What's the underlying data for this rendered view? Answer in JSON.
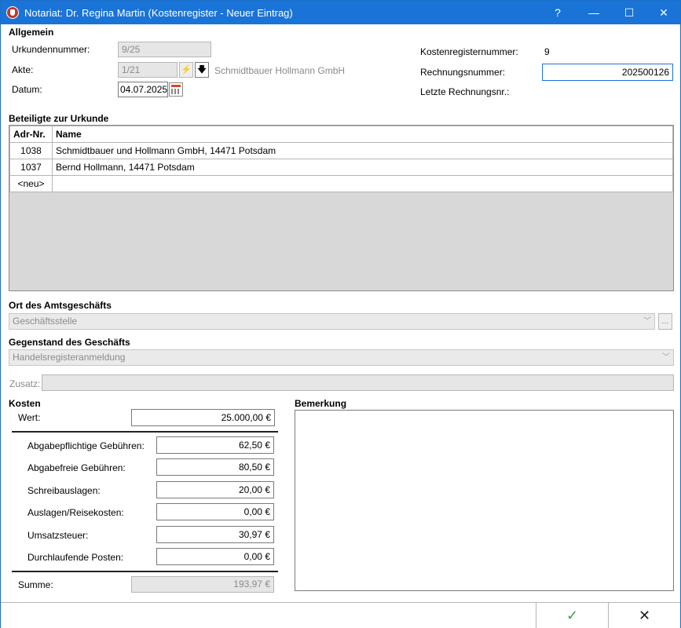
{
  "window": {
    "title": "Notariat: Dr. Regina Martin (Kostenregister - Neuer Eintrag)",
    "help": "?",
    "minimize": "—",
    "maximize": "☐",
    "close": "✕"
  },
  "allgemein": {
    "section": "Allgemein",
    "urkundennummer_label": "Urkundennummer:",
    "urkundennummer": "9/25",
    "akte_label": "Akte:",
    "akte": "1/21",
    "akte_btn1": "⚡",
    "akte_btn2": "🡇",
    "akte_name": "Schmidtbauer  Hollmann GmbH",
    "datum_label": "Datum:",
    "datum": "04.07.2025",
    "kostenregisternummer_label": "Kostenregisternummer:",
    "kostenregisternummer": "9",
    "rechnungsnummer_label": "Rechnungsnummer:",
    "rechnungsnummer": "202500126",
    "letzte_label": "Letzte Rechnungsnr.:"
  },
  "beteiligte": {
    "section": "Beteiligte zur Urkunde",
    "col_adr": "Adr-Nr.",
    "col_name": "Name",
    "rows": [
      {
        "adr": "1038",
        "name": "Schmidtbauer und Hollmann GmbH, 14471 Potsdam"
      },
      {
        "adr": "1037",
        "name": "Bernd Hollmann, 14471 Potsdam"
      },
      {
        "adr": "<neu>",
        "name": ""
      }
    ]
  },
  "ort": {
    "section": "Ort des Amtsgeschäfts",
    "value": "Geschäftsstelle",
    "btn": "..."
  },
  "gegenstand": {
    "section": "Gegenstand des Geschäfts",
    "value": "Handelsregisteranmeldung",
    "zusatz_label": "Zusatz:",
    "zusatz": ""
  },
  "kosten": {
    "section": "Kosten",
    "wert_label": "Wert:",
    "wert": "25.000,00 €",
    "items": [
      {
        "label": "Abgabepflichtige Gebühren:",
        "value": "62,50 €"
      },
      {
        "label": "Abgabefreie Gebühren:",
        "value": "80,50 €"
      },
      {
        "label": "Schreibauslagen:",
        "value": "20,00 €"
      },
      {
        "label": "Auslagen/Reisekosten:",
        "value": "0,00 €"
      },
      {
        "label": "Umsatzsteuer:",
        "value": "30,97 €"
      },
      {
        "label": "Durchlaufende Posten:",
        "value": "0,00 €"
      }
    ],
    "summe_label": "Summe:",
    "summe": "193,97 €"
  },
  "bemerkung": {
    "section": "Bemerkung",
    "value": ""
  },
  "footer": {
    "ok": "✓",
    "cancel": "✕",
    "ok_color": "#3aa54a"
  }
}
